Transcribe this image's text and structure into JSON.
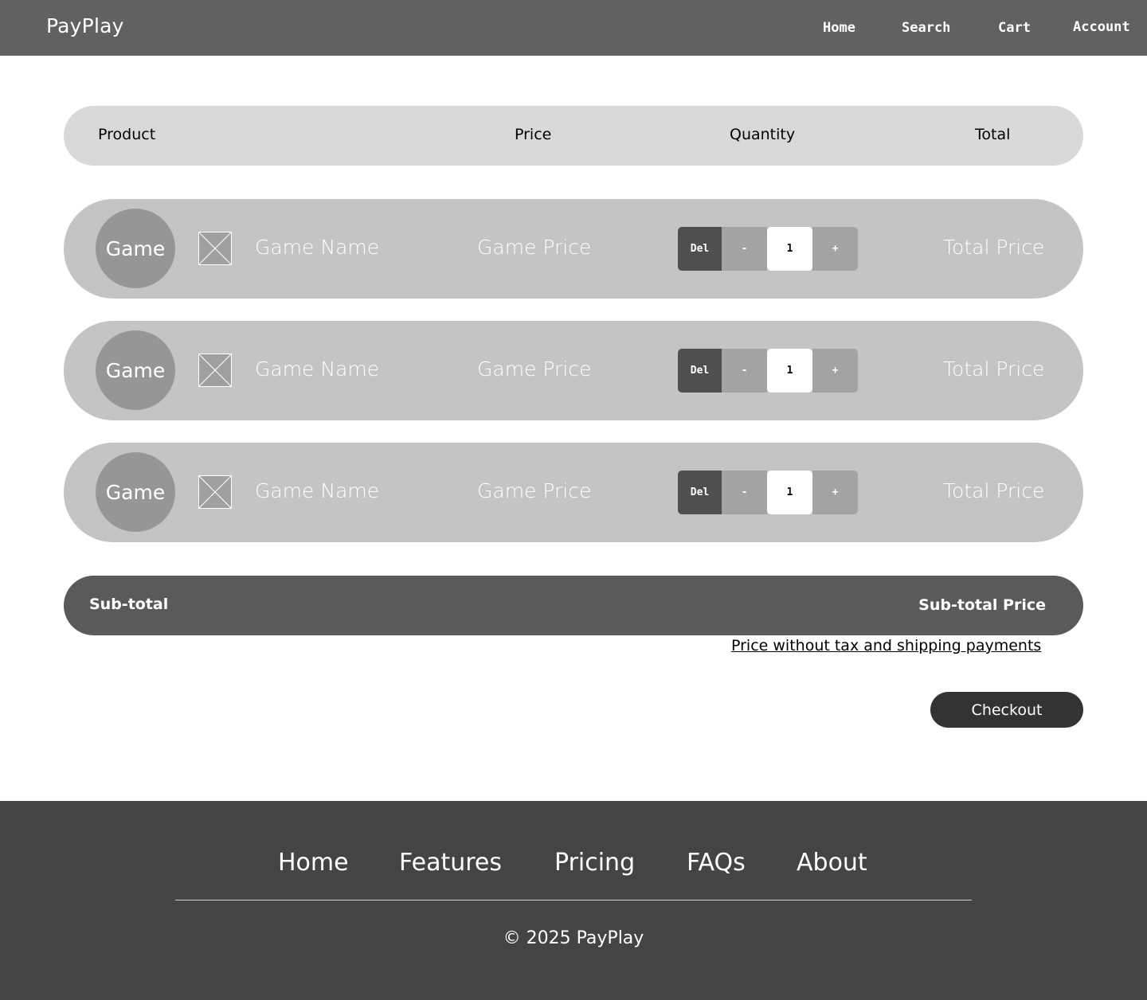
{
  "header": {
    "brand": "PayPlay",
    "nav": [
      "Home",
      "Search",
      "Cart",
      "Account"
    ]
  },
  "table": {
    "columns": [
      "Product",
      "Price",
      "Quantity",
      "Total"
    ]
  },
  "rows": [
    {
      "avatar": "Game",
      "name": "Game Name",
      "price": "Game Price",
      "del": "Del",
      "minus": "-",
      "qty": "1",
      "plus": "+",
      "total": "Total Price"
    },
    {
      "avatar": "Game",
      "name": "Game Name",
      "price": "Game Price",
      "del": "Del",
      "minus": "-",
      "qty": "1",
      "plus": "+",
      "total": "Total Price"
    },
    {
      "avatar": "Game",
      "name": "Game Name",
      "price": "Game Price",
      "del": "Del",
      "minus": "-",
      "qty": "1",
      "plus": "+",
      "total": "Total Price"
    }
  ],
  "summary": {
    "label": "Sub-total",
    "value": "Sub-total Price",
    "note": "Price without tax and shipping payments",
    "checkout": "Checkout"
  },
  "footer": {
    "nav": [
      "Home",
      "Features",
      "Pricing",
      "FAQs",
      "About"
    ],
    "copyright": "© 2025 PayPlay"
  },
  "icons": {
    "row_thumbnail": "image-placeholder-icon"
  },
  "colors": {
    "header_bg": "#616161",
    "row_bg": "#c4c4c4",
    "subtotal_bg": "#5a5a5a",
    "checkout_bg": "#333333",
    "footer_bg": "#444444"
  }
}
